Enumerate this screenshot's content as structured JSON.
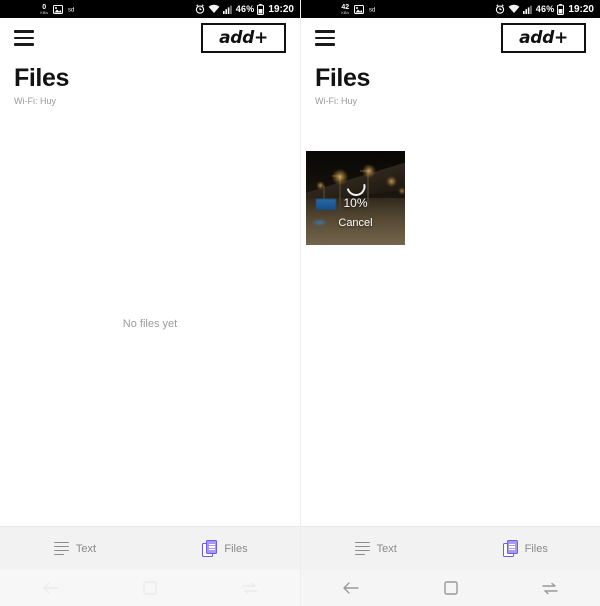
{
  "screens": [
    {
      "name": "empty-state",
      "statusbar": {
        "net_speed_value": "0",
        "net_speed_unit": "KB/s",
        "icons": [
          "image-icon",
          "sim-icon"
        ],
        "right_icons": [
          "alarm-icon",
          "wifi-icon",
          "signal-icon"
        ],
        "battery_percent": "46%",
        "clock": "19:20"
      },
      "appbar": {
        "menu_icon": "hamburger-menu-icon",
        "logo": "add+"
      },
      "title": "Files",
      "subtitle": "Wi-Fi: Huy",
      "empty_message": "No files yet",
      "upload": null,
      "tabs": [
        {
          "label": "Text",
          "icon": "text-lines-icon",
          "active": false
        },
        {
          "label": "Files",
          "icon": "documents-icon",
          "active": true
        }
      ],
      "navbar": {
        "back": "back-arrow-icon",
        "home": "home-square-icon",
        "recents": "recents-icon",
        "dimmed": true
      }
    },
    {
      "name": "uploading-state",
      "statusbar": {
        "net_speed_value": "42",
        "net_speed_unit": "KB/s",
        "icons": [
          "image-icon",
          "sim-icon"
        ],
        "right_icons": [
          "alarm-icon",
          "wifi-icon",
          "signal-icon"
        ],
        "battery_percent": "46%",
        "clock": "19:20"
      },
      "appbar": {
        "menu_icon": "hamburger-menu-icon",
        "logo": "add+"
      },
      "title": "Files",
      "subtitle": "Wi-Fi: Huy",
      "empty_message": "",
      "upload": {
        "progress_label": "10%",
        "progress_value": 10,
        "cancel_label": "Cancel",
        "thumbnail_alt": "night street photo"
      },
      "tabs": [
        {
          "label": "Text",
          "icon": "text-lines-icon",
          "active": false
        },
        {
          "label": "Files",
          "icon": "documents-icon",
          "active": true
        }
      ],
      "navbar": {
        "back": "back-arrow-icon",
        "home": "home-square-icon",
        "recents": "recents-icon",
        "dimmed": false
      }
    }
  ],
  "colors": {
    "accent": "#6c5ce7",
    "statusbar_bg": "#000000",
    "tabbar_bg": "#f2f2f2",
    "navbar_bg": "#f5f5f5",
    "muted_text": "#8a8a8a"
  }
}
